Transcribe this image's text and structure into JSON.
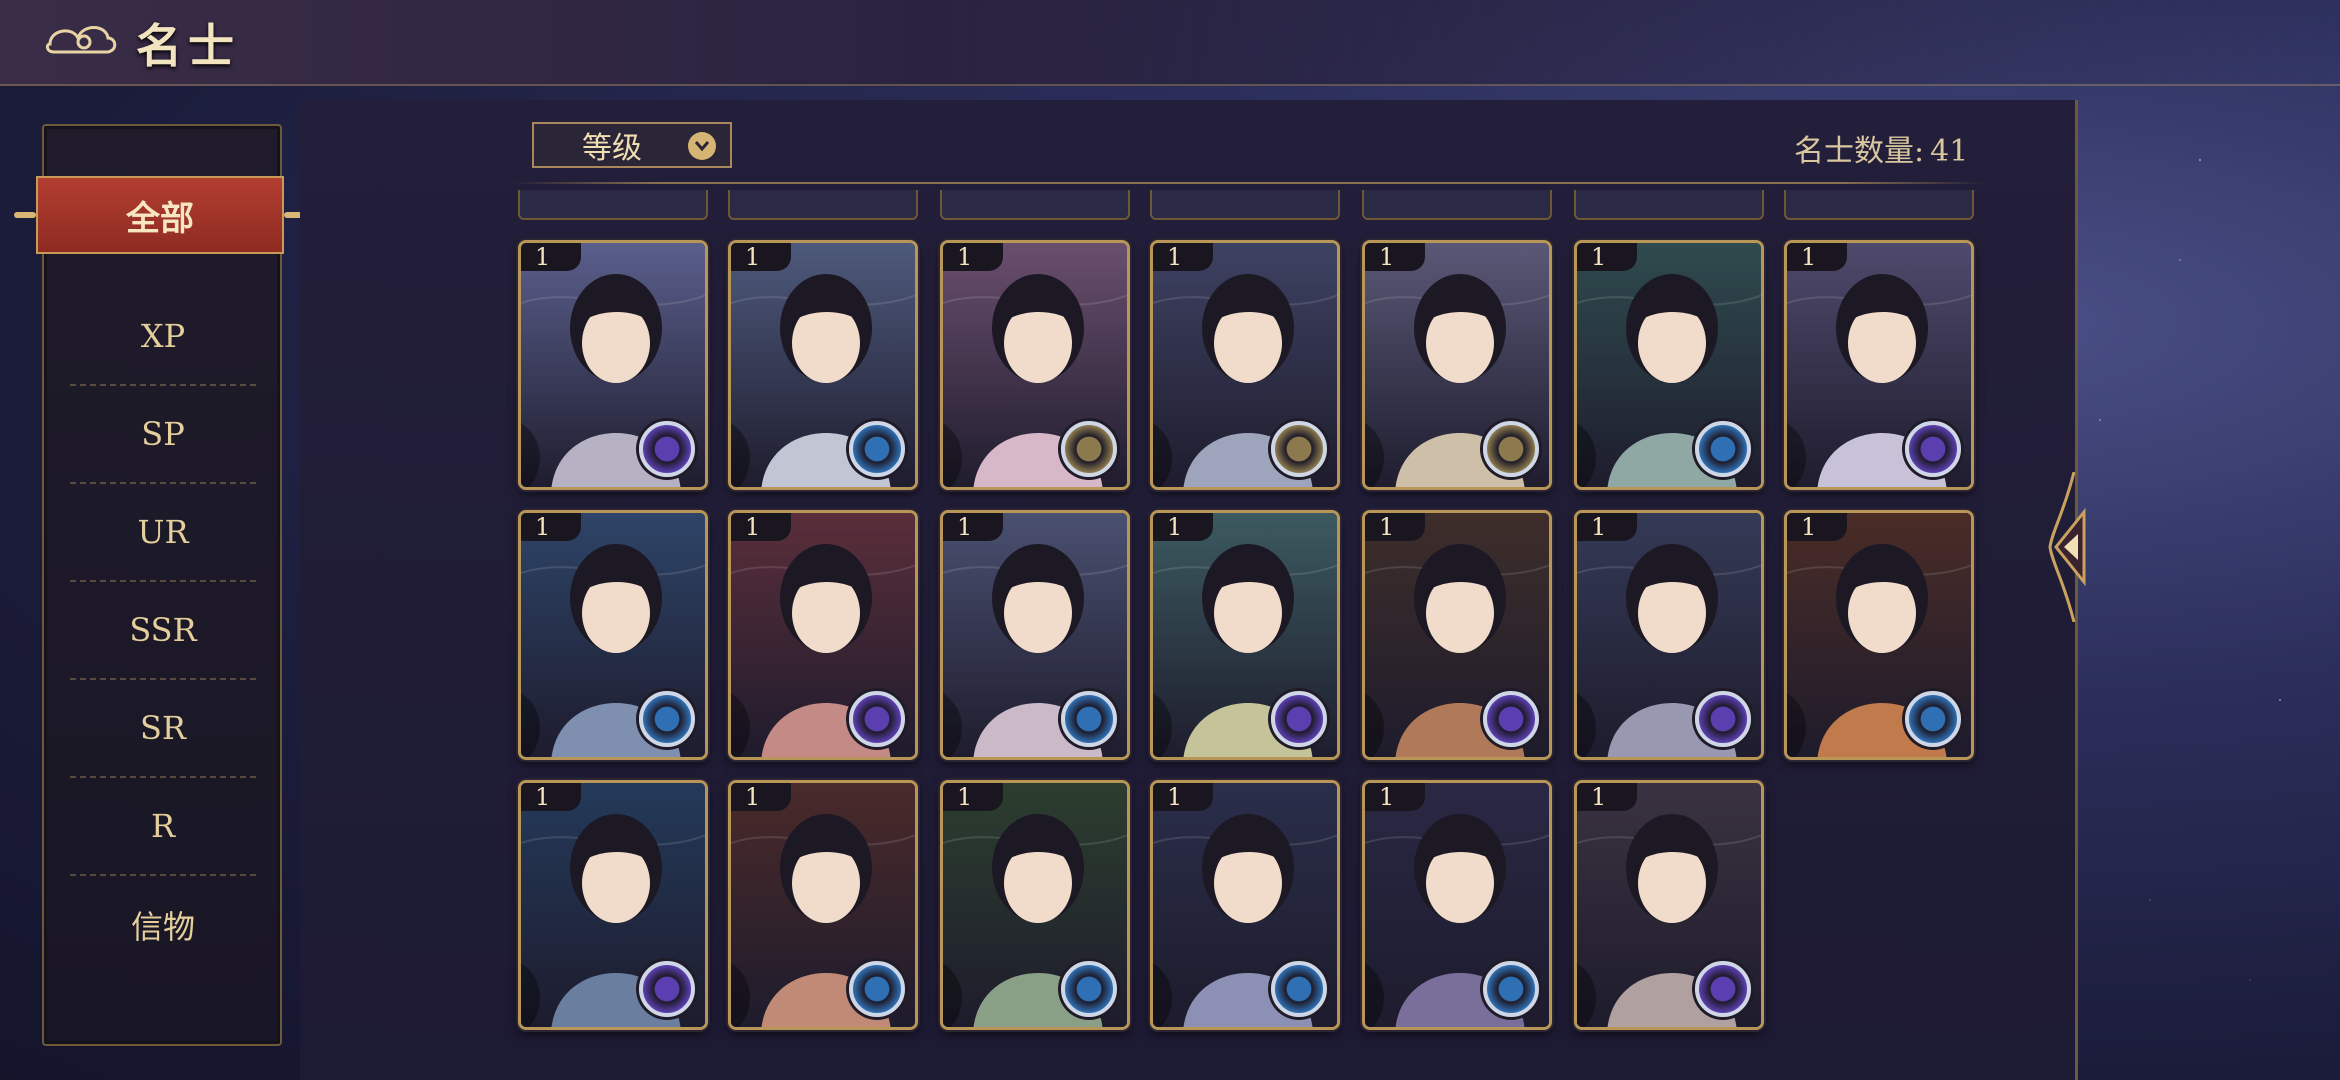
{
  "header": {
    "title": "名士"
  },
  "sidebar": {
    "active": "全部",
    "items": [
      "XP",
      "SP",
      "UR",
      "SSR",
      "SR",
      "R",
      "信物"
    ]
  },
  "toolbar": {
    "sort_label": "等级",
    "count_label": "名士数量:",
    "count_value": "41"
  },
  "cards": [
    {
      "level": "1",
      "badge": "purple"
    },
    {
      "level": "1",
      "badge": "blue"
    },
    {
      "level": "1",
      "badge": "gold"
    },
    {
      "level": "1",
      "badge": "gold"
    },
    {
      "level": "1",
      "badge": "gold"
    },
    {
      "level": "1",
      "badge": "blue"
    },
    {
      "level": "1",
      "badge": "purple"
    },
    {
      "level": "1",
      "badge": "blue"
    },
    {
      "level": "1",
      "badge": "purple"
    },
    {
      "level": "1",
      "badge": "blue"
    },
    {
      "level": "1",
      "badge": "purple"
    },
    {
      "level": "1",
      "badge": "purple"
    },
    {
      "level": "1",
      "badge": "purple"
    },
    {
      "level": "1",
      "badge": "blue"
    },
    {
      "level": "1",
      "badge": "purple"
    },
    {
      "level": "1",
      "badge": "blue"
    },
    {
      "level": "1",
      "badge": "blue"
    },
    {
      "level": "1",
      "badge": "blue"
    },
    {
      "level": "1",
      "badge": "blue"
    },
    {
      "level": "1",
      "badge": "purple"
    }
  ],
  "badge_colors": {
    "purple": "#5b3fb0",
    "blue": "#2f6fb3",
    "gold": "#8c7a4e"
  },
  "colors": {
    "accent_red": "#a8372b",
    "gold": "#c8a25e"
  }
}
